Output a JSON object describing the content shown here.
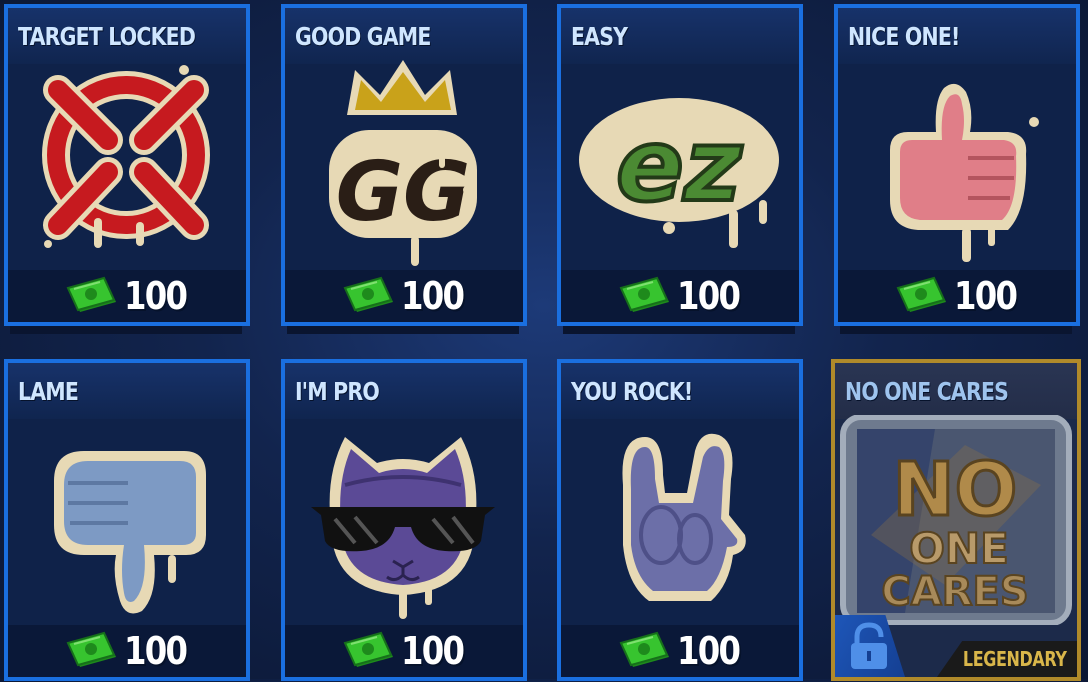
{
  "currency_icon": "cash-icon",
  "cards": [
    {
      "title": "TARGET LOCKED",
      "price": "100",
      "icon": "crosshair-spray"
    },
    {
      "title": "GOOD GAME",
      "price": "100",
      "icon": "gg-crown-spray"
    },
    {
      "title": "EASY",
      "price": "100",
      "icon": "ez-spray"
    },
    {
      "title": "NICE ONE!",
      "price": "100",
      "icon": "thumbs-up-spray"
    },
    {
      "title": "LAME",
      "price": "100",
      "icon": "thumbs-down-spray"
    },
    {
      "title": "I'M PRO",
      "price": "100",
      "icon": "cool-cat-spray"
    },
    {
      "title": "YOU ROCK!",
      "price": "100",
      "icon": "rock-hand-spray"
    },
    {
      "title": "NO ONE CARES",
      "rarity": "LEGENDARY",
      "icon": "no-one-cares-spray",
      "locked": true
    }
  ],
  "colors": {
    "card_border": "#1a6fe0",
    "legendary_border": "#b08a2a",
    "legendary_text": "#d9b64a",
    "cash_green": "#2fb82a"
  }
}
